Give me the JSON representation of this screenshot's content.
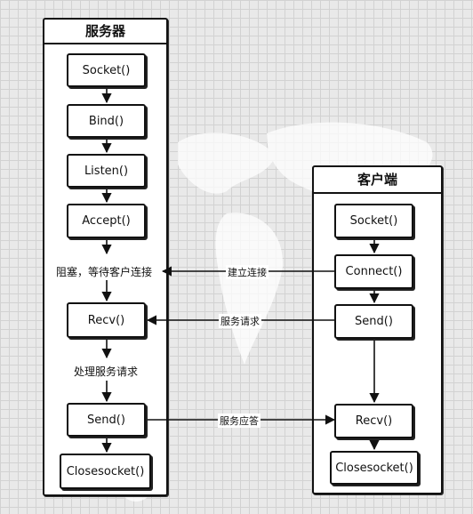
{
  "server": {
    "title": "服务器",
    "steps": [
      "Socket()",
      "Bind()",
      "Listen()",
      "Accept()",
      "Recv()",
      "Send()",
      "Closesocket()"
    ],
    "note_block": "阻塞，等待客户连接",
    "note_process": "处理服务请求"
  },
  "client": {
    "title": "客户端",
    "steps": [
      "Socket()",
      "Connect()",
      "Send()",
      "Recv()",
      "Closesocket()"
    ]
  },
  "edges": {
    "connect": "建立连接",
    "request": "服务请求",
    "response": "服务应答"
  }
}
